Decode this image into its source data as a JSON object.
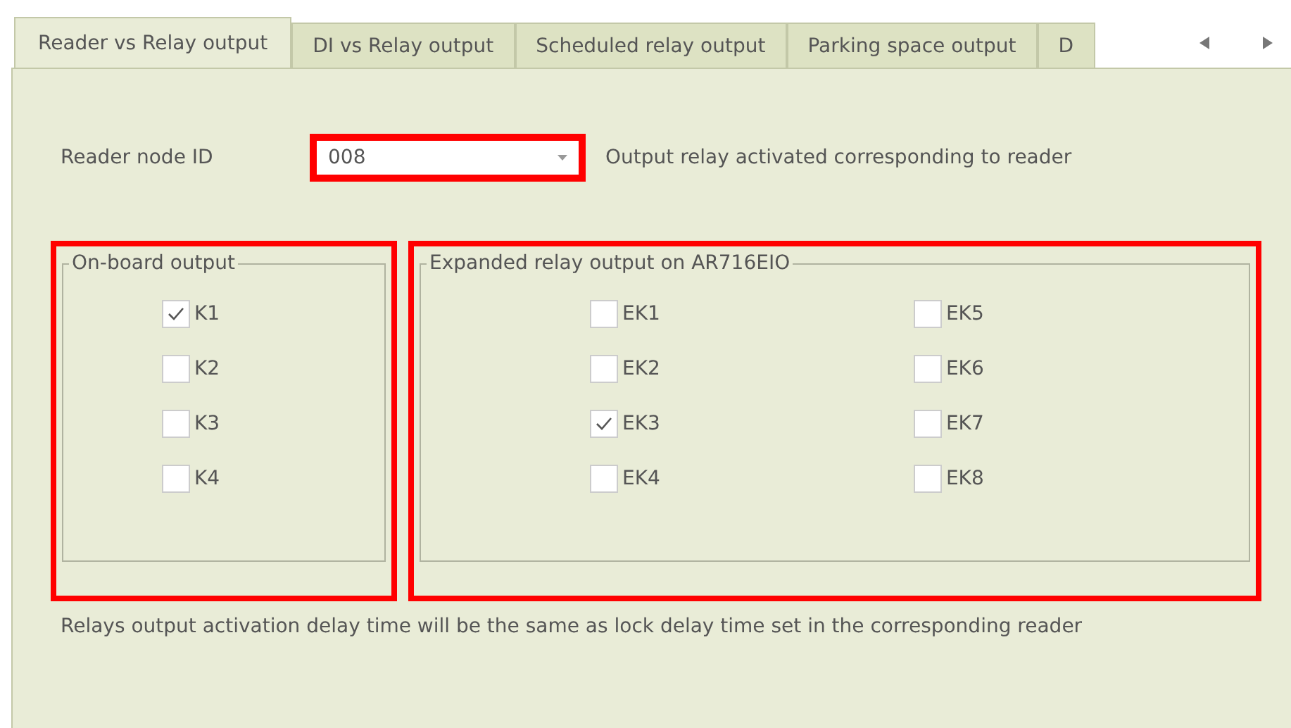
{
  "tabs": [
    {
      "label": "Reader vs Relay output",
      "selected": true
    },
    {
      "label": "DI vs Relay output",
      "selected": false
    },
    {
      "label": "Scheduled relay output",
      "selected": false
    },
    {
      "label": "Parking space output",
      "selected": false
    },
    {
      "label": "D",
      "selected": false
    }
  ],
  "reader": {
    "label": "Reader node ID",
    "value": "008",
    "highlighted": true,
    "hint": "Output relay activated corresponding to reader"
  },
  "groups": [
    {
      "title": "On-board output",
      "highlighted": true,
      "columns": [
        [
          {
            "label": "K1",
            "checked": true
          },
          {
            "label": "K2",
            "checked": false
          },
          {
            "label": "K3",
            "checked": false
          },
          {
            "label": "K4",
            "checked": false
          }
        ]
      ]
    },
    {
      "title": "Expanded relay output on AR716EIO",
      "highlighted": true,
      "columns": [
        [
          {
            "label": "EK1",
            "checked": false
          },
          {
            "label": "EK2",
            "checked": false
          },
          {
            "label": "EK3",
            "checked": true
          },
          {
            "label": "EK4",
            "checked": false
          }
        ],
        [
          {
            "label": "EK5",
            "checked": false
          },
          {
            "label": "EK6",
            "checked": false
          },
          {
            "label": "EK7",
            "checked": false
          },
          {
            "label": "EK8",
            "checked": false
          }
        ]
      ]
    }
  ],
  "note": "Relays output activation delay time will be the same as lock delay time set in the corresponding reader"
}
